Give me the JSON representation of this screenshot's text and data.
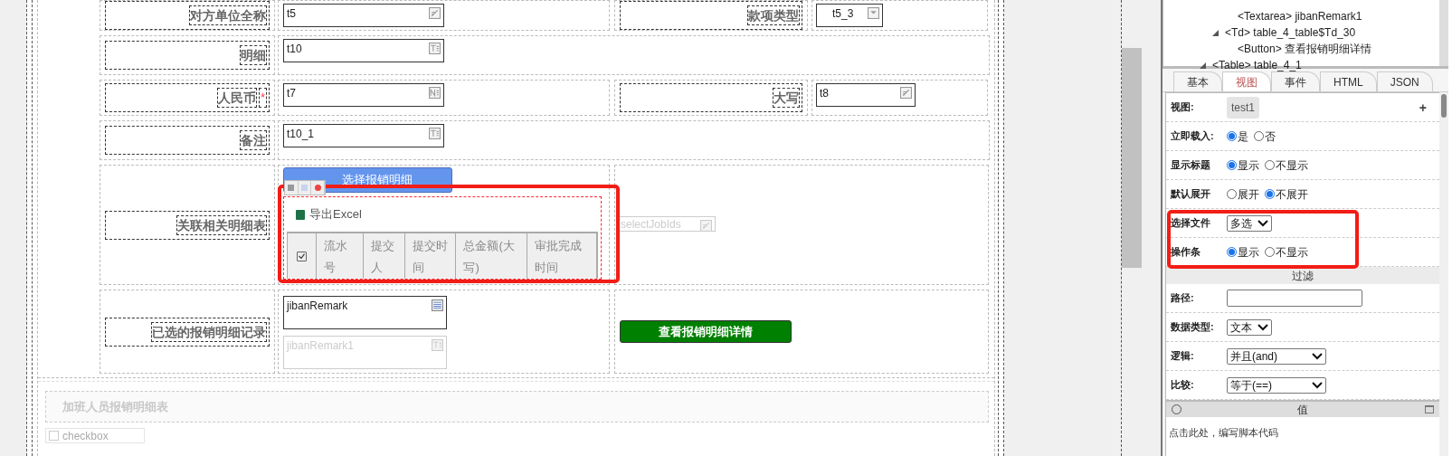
{
  "form": {
    "rows": [
      {
        "kind": "two",
        "label": "对方单位全称",
        "field": {
          "value": "t5",
          "kind": "edit",
          "disabled": false
        },
        "label_2": "款项类型",
        "field_2": {
          "value": "t5_3",
          "kind": "dropdown",
          "disabled": false
        }
      },
      {
        "kind": "wide",
        "label": "明细",
        "field": {
          "value": "t10",
          "kind": "text",
          "disabled": false
        }
      },
      {
        "kind": "two",
        "label": "人民币",
        "required_mark": "*",
        "field": {
          "value": "t7",
          "kind": "number",
          "disabled": false
        },
        "label_2": "大写",
        "field_2": {
          "value": "t8",
          "kind": "edit",
          "disabled": false
        }
      },
      {
        "kind": "wide",
        "label": "备注",
        "field": {
          "value": "t10_1",
          "kind": "text",
          "disabled": false
        }
      },
      {
        "kind": "grid",
        "label": "关联相关明细表",
        "button": "选择报销明细",
        "export": "导出Excel",
        "select_all_checked": true,
        "columns": [
          "流水号",
          "提交人",
          "提交时间",
          "总金额(大写)",
          "审批完成时间"
        ],
        "hidden_field": {
          "value": "selectJobIds",
          "kind": "edit",
          "disabled": true
        }
      },
      {
        "kind": "remark",
        "label": "已选的报销明细记录",
        "field": {
          "value": "jibanRemark",
          "kind": "textarea",
          "disabled": false
        },
        "field_2": {
          "value": "jibanRemark1",
          "kind": "text",
          "disabled": true
        },
        "button": "查看报销明细详情"
      }
    ]
  },
  "section": {
    "title": "加班人员报销明细表",
    "checkbox": "checkbox"
  },
  "tree": {
    "items": [
      {
        "children": [
          {
            "children": [
              {
                "label": "<Textarea> jibanRemark1"
              }
            ]
          },
          {
            "label": "<Td> table_4_table$Td_30",
            "expanded": true,
            "children": [
              {
                "label": "<Button> 查看报销明细详情"
              }
            ]
          }
        ]
      },
      {
        "label": "<Table> table_4_1",
        "expanded": true
      }
    ]
  },
  "tabs": [
    {
      "label": "基本",
      "selected": false
    },
    {
      "label": "视图",
      "selected": true
    },
    {
      "label": "事件",
      "selected": false
    },
    {
      "label": "HTML",
      "selected": false
    },
    {
      "label": "JSON",
      "selected": false
    }
  ],
  "properties": [
    {
      "kind": "chip",
      "label": "视图:",
      "value": "test1",
      "action": "+"
    },
    {
      "kind": "radio",
      "label": "立即载入:",
      "options": [
        {
          "label": "是",
          "selected": true
        },
        {
          "label": "否",
          "selected": false
        }
      ]
    },
    {
      "kind": "radio",
      "label": "显示标题",
      "options": [
        {
          "label": "显示",
          "selected": true
        },
        {
          "label": "不显示",
          "selected": false
        }
      ]
    },
    {
      "kind": "radio",
      "label": "默认展开",
      "options": [
        {
          "label": "展开",
          "selected": false
        },
        {
          "label": "不展开",
          "selected": true
        }
      ]
    },
    {
      "kind": "select",
      "label": "选择文件",
      "value": "多选"
    },
    {
      "kind": "radio",
      "label": "操作条",
      "options": [
        {
          "label": "显示",
          "selected": true
        },
        {
          "label": "不显示",
          "selected": false
        }
      ]
    },
    {
      "kind": "header",
      "label": "过滤"
    },
    {
      "kind": "input",
      "label": "路径:"
    },
    {
      "kind": "select",
      "label": "数据类型:",
      "value": "文本"
    },
    {
      "kind": "select",
      "label": "逻辑:",
      "value": "并且(and)"
    },
    {
      "kind": "select",
      "label": "比较:",
      "value": "等于(==)"
    },
    {
      "kind": "header",
      "label": "值"
    },
    {
      "kind": "script",
      "text": "点击此处，编写脚本代码"
    }
  ]
}
